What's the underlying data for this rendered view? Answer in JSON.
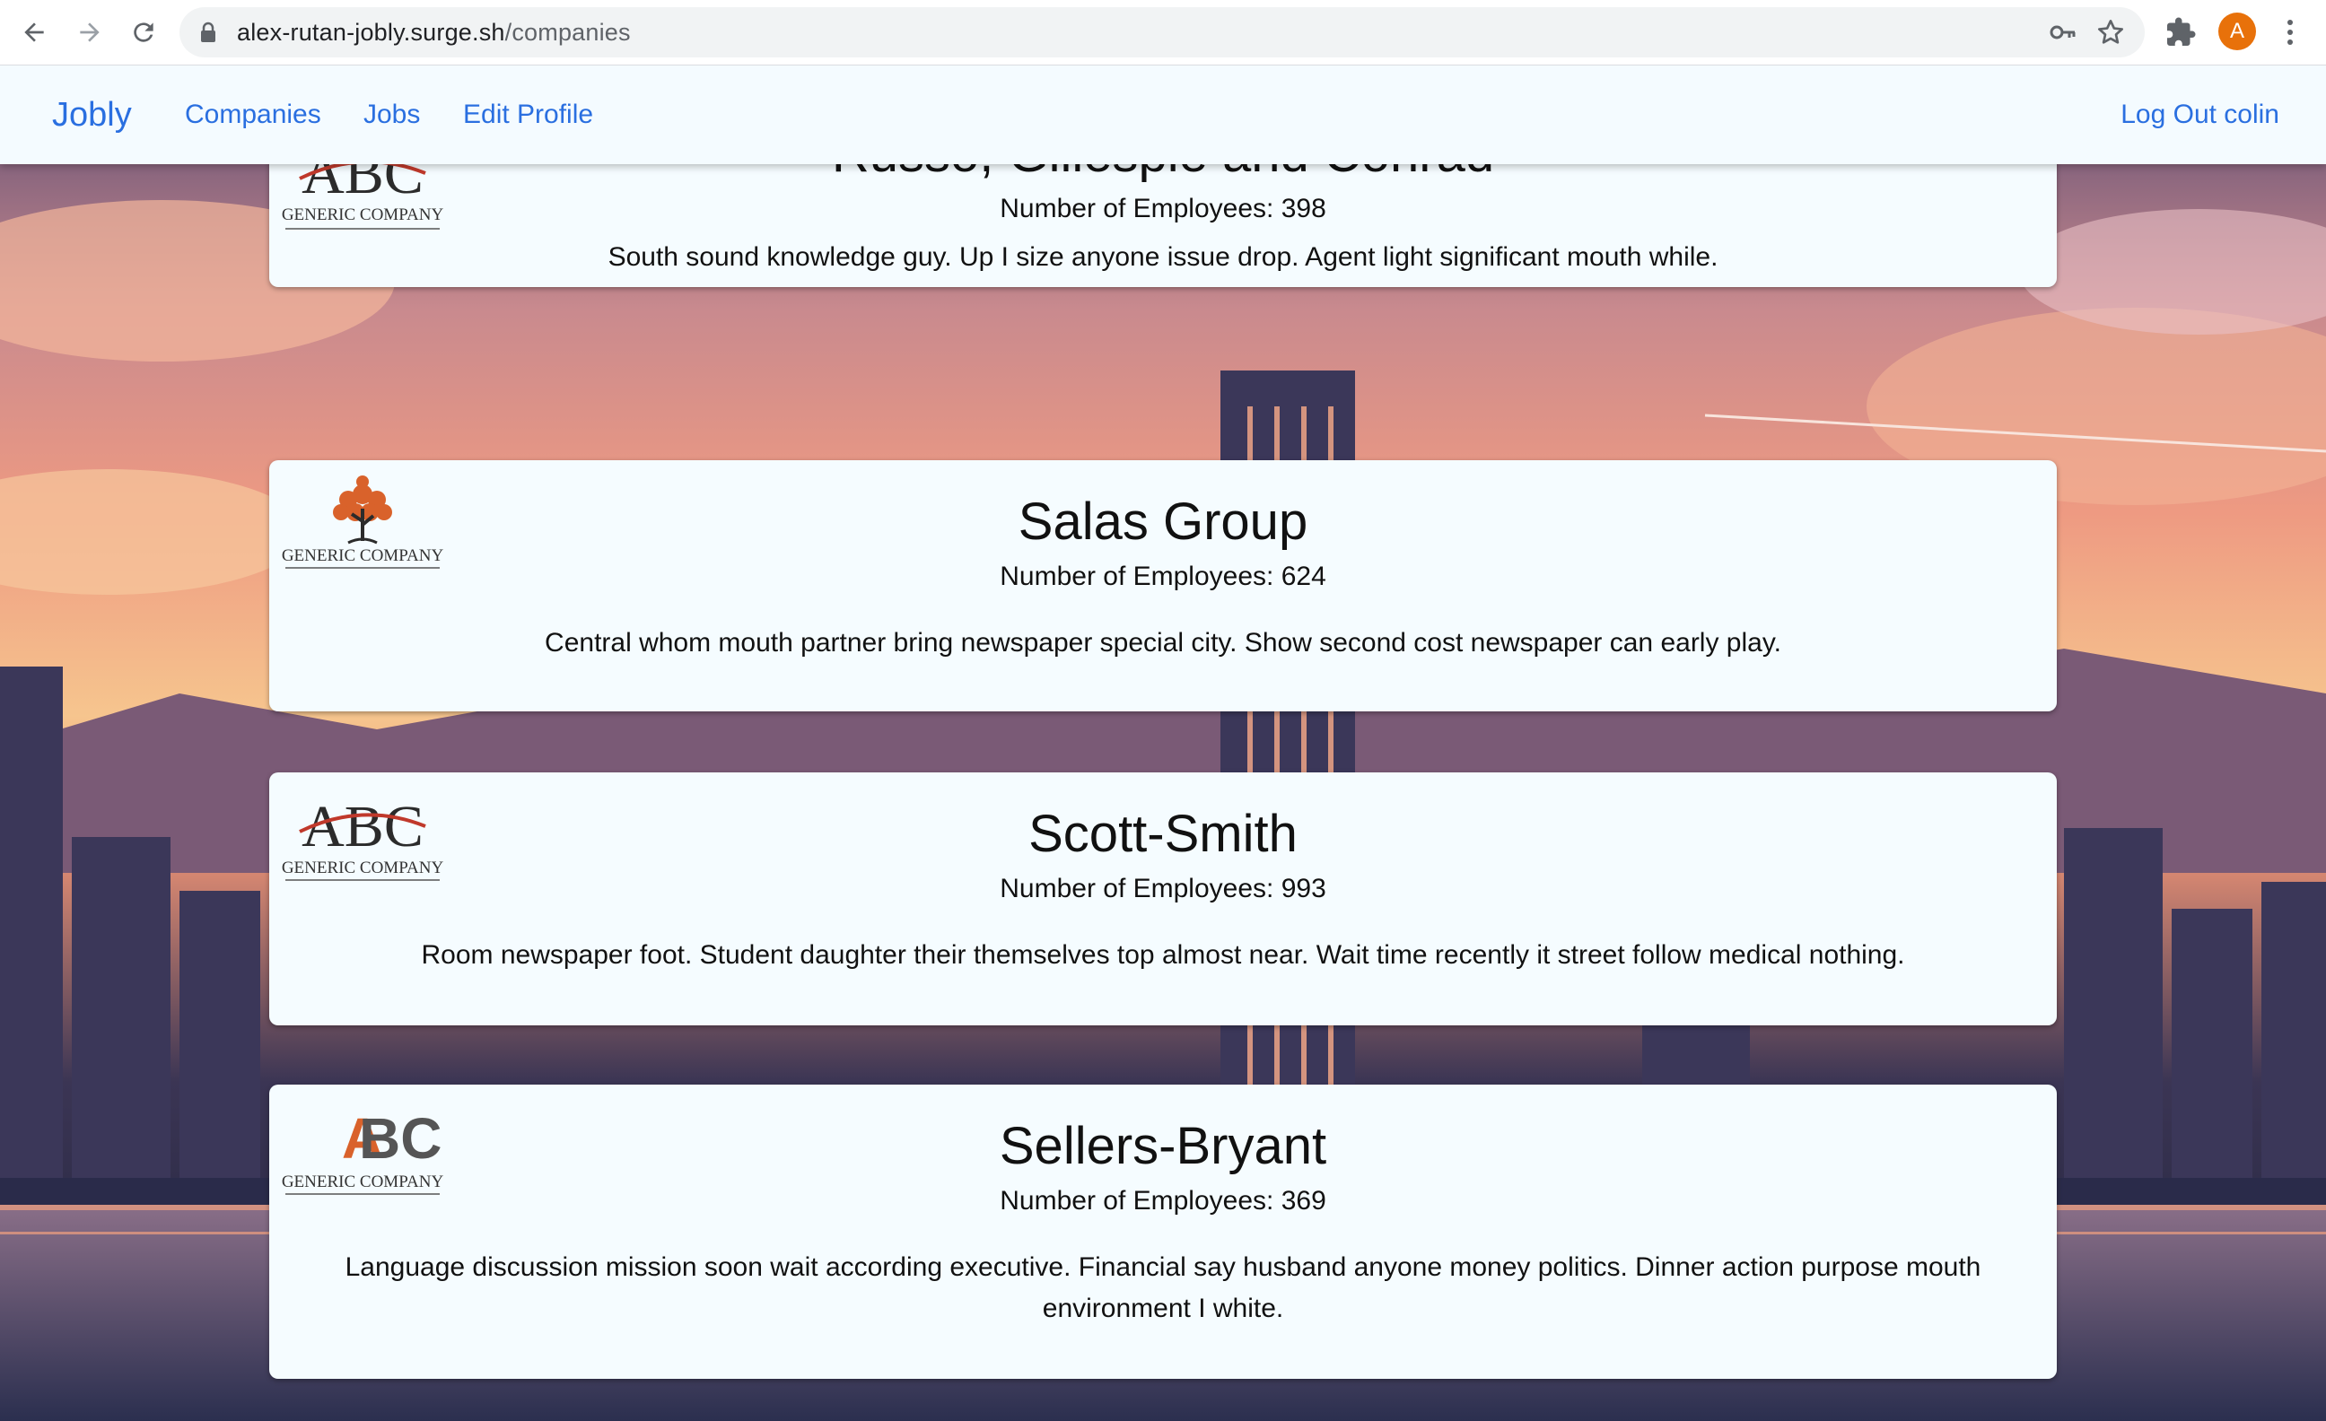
{
  "browser": {
    "url_host": "alex-rutan-jobly.surge.sh",
    "url_path": "/companies",
    "profile_initial": "A"
  },
  "navbar": {
    "brand": "Jobly",
    "links": [
      "Companies",
      "Jobs",
      "Edit Profile"
    ],
    "logout": "Log Out colin"
  },
  "companies": [
    {
      "name": "Russo, Gillespie and Conrad",
      "employees": "Number of Employees: 398",
      "description": "South sound knowledge guy. Up I size anyone issue drop. Agent light significant mouth while.",
      "logo": "abc-serif-logo",
      "logo_text": "GENERIC COMPANY"
    },
    {
      "name": "Salas Group",
      "employees": "Number of Employees: 624",
      "description": "Central whom mouth partner bring newspaper special city. Show second cost newspaper can early play.",
      "logo": "tree-logo",
      "logo_text": "GENERIC COMPANY"
    },
    {
      "name": "Scott-Smith",
      "employees": "Number of Employees: 993",
      "description": "Room newspaper foot. Student daughter their themselves top almost near. Wait time recently it street follow medical nothing.",
      "logo": "abc-serif-logo",
      "logo_text": "GENERIC COMPANY"
    },
    {
      "name": "Sellers-Bryant",
      "employees": "Number of Employees: 369",
      "description": "Language discussion mission soon wait according executive. Financial say husband anyone money politics. Dinner action purpose mouth environment I white.",
      "logo": "abc-bold-logo",
      "logo_text": "GENERIC COMPANY"
    }
  ],
  "colors": {
    "link": "#2a6fe0",
    "navbar_bg": "#f4fbff",
    "card_bg": "#f5fcff",
    "avatar": "#e8710a",
    "logo_red": "#c0392b",
    "logo_orange": "#d9622b"
  }
}
